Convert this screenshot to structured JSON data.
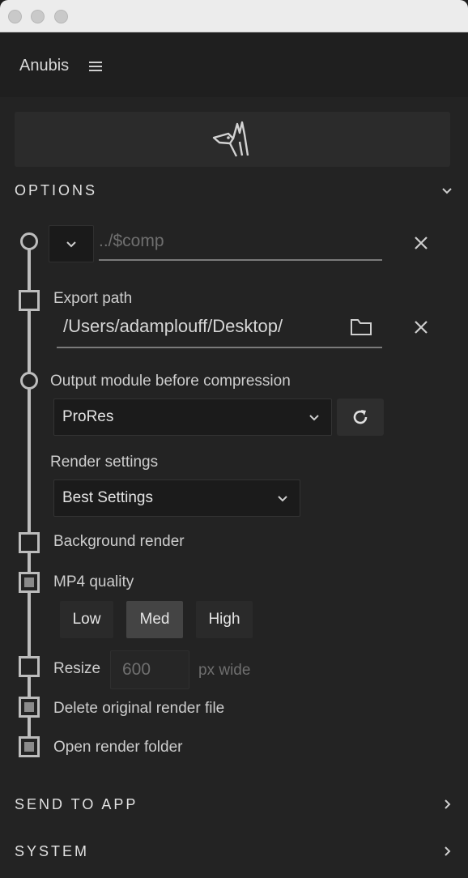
{
  "app": {
    "name": "Anubis"
  },
  "sections": {
    "options": "OPTIONS",
    "send_to_app": "SEND TO APP",
    "system": "SYSTEM"
  },
  "options": {
    "path_template": {
      "placeholder": "../$comp"
    },
    "export_path": {
      "label": "Export path",
      "value": "/Users/adamplouff/Desktop/"
    },
    "output_module": {
      "label": "Output module before compression",
      "value": "ProRes"
    },
    "render_settings": {
      "label": "Render settings",
      "value": "Best Settings"
    },
    "background_render": {
      "label": "Background render",
      "checked": false
    },
    "mp4_quality": {
      "label": "MP4 quality",
      "checked": true,
      "options": [
        "Low",
        "Med",
        "High"
      ],
      "selected": "Med"
    },
    "resize": {
      "label": "Resize",
      "checked": false,
      "placeholder": "600",
      "unit": "px wide"
    },
    "delete_original": {
      "label": "Delete original render file",
      "checked": true
    },
    "open_folder": {
      "label": "Open render folder",
      "checked": true
    }
  },
  "icons": [
    "menu-icon",
    "anubis-logo-icon",
    "chevron-down-icon",
    "chevron-right-icon",
    "close-icon",
    "folder-icon",
    "refresh-icon"
  ]
}
